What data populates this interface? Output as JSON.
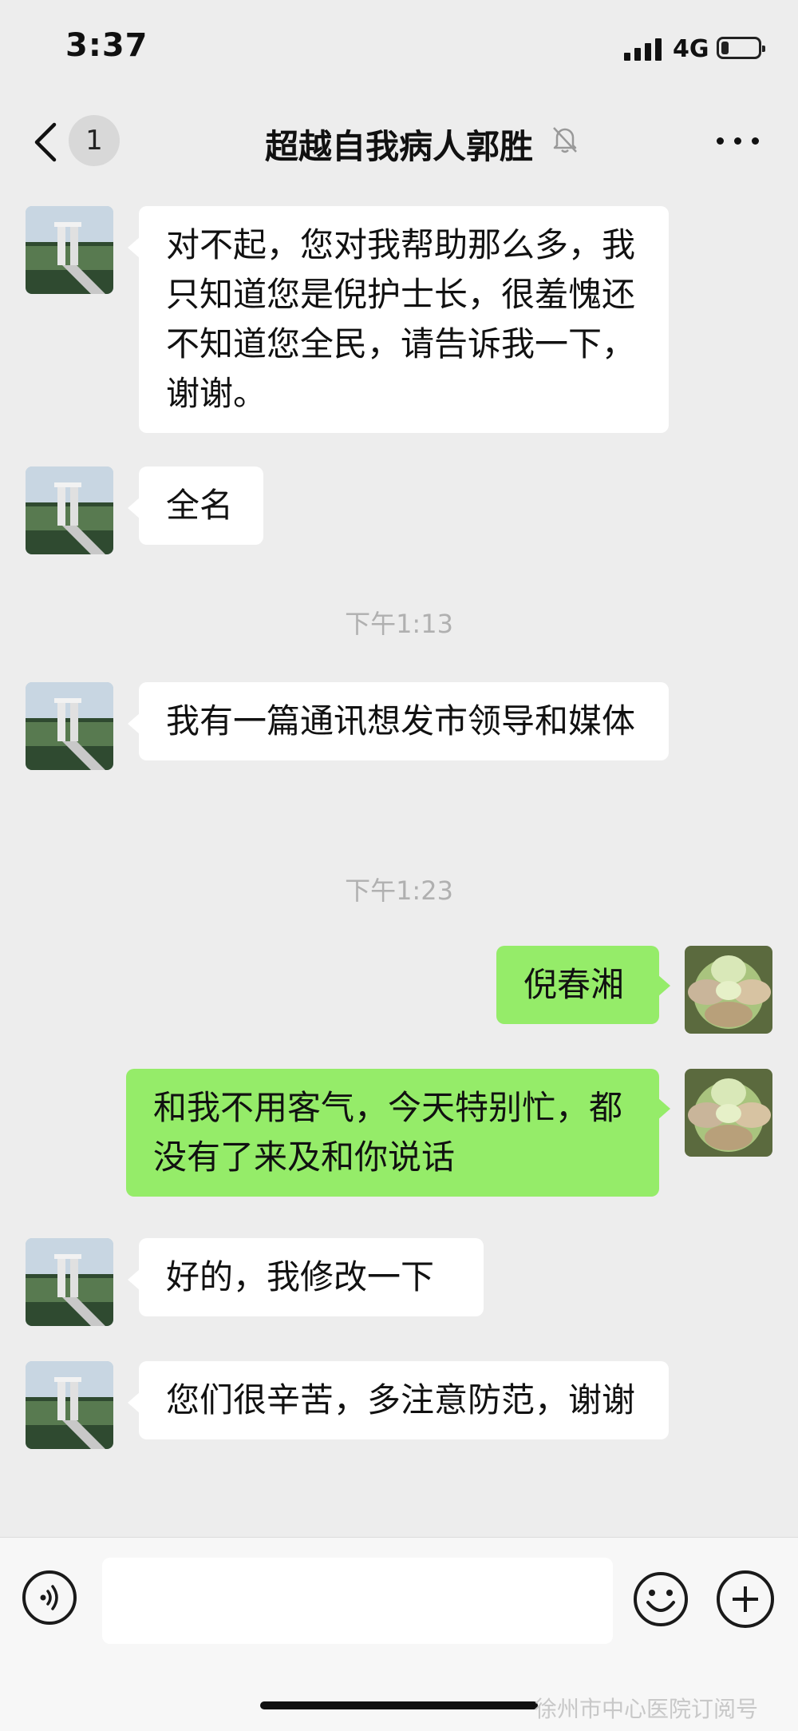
{
  "status_bar": {
    "time": "3:37",
    "network": "4G",
    "battery_level": 0.2
  },
  "nav": {
    "back_count": "1",
    "title": "超越自我病人郭胜",
    "muted": true
  },
  "messages": [
    {
      "side": "left",
      "text": "对不起，您对我帮助那么多，我只知道您是倪护士长，很羞愧还不知道您全民，请告诉我一下，谢谢。"
    },
    {
      "side": "left",
      "text": "全名"
    },
    {
      "timestamp": "下午1:13"
    },
    {
      "side": "left",
      "text": "我有一篇通讯想发市领导和媒体"
    },
    {
      "timestamp": "下午1:23"
    },
    {
      "side": "right",
      "text": "倪春湘"
    },
    {
      "side": "right",
      "text": "和我不用客气，今天特别忙，都没有了来及和你说话"
    },
    {
      "side": "left",
      "text": "好的，我修改一下"
    },
    {
      "side": "left",
      "text": "您们很辛苦，多注意防范，谢谢"
    }
  ],
  "watermark": "徐州市中心医院订阅号",
  "icons": {
    "back": "chevron-left-icon",
    "mute": "bell-off-icon",
    "more": "more-dots-icon",
    "voice": "voice-icon",
    "emoji": "emoji-icon",
    "plus": "plus-icon"
  },
  "colors": {
    "background": "#ededed",
    "incoming_bubble": "#ffffff",
    "outgoing_bubble": "#95ec69"
  }
}
